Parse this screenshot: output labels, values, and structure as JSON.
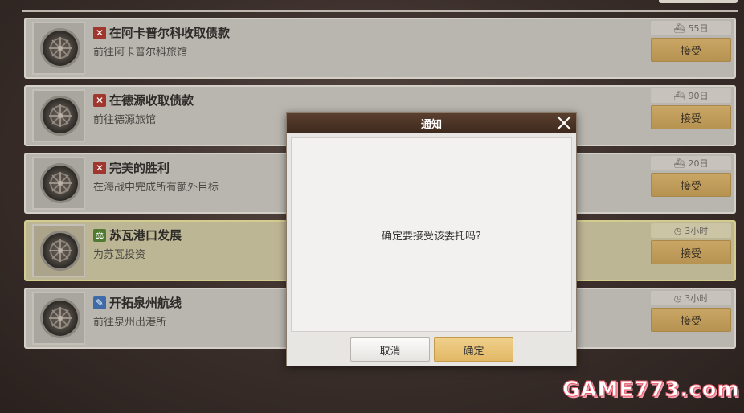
{
  "quests": [
    {
      "tag_icon": "crossed-swords-icon",
      "tag_color": "#a0362e",
      "title": "在阿卡普尔科收取债款",
      "subtitle": "前往阿卡普尔科旅馆",
      "time_icon": "ship-icon",
      "time": "55日",
      "accept_label": "接受",
      "highlighted": false
    },
    {
      "tag_icon": "crossed-swords-icon",
      "tag_color": "#a0362e",
      "title": "在德源收取债款",
      "subtitle": "前往德源旅馆",
      "time_icon": "ship-icon",
      "time": "90日",
      "accept_label": "接受",
      "highlighted": false
    },
    {
      "tag_icon": "crossed-swords-icon",
      "tag_color": "#a0362e",
      "title": "完美的胜利",
      "subtitle": "在海战中完成所有额外目标",
      "time_icon": "ship-icon",
      "time": "20日",
      "accept_label": "接受",
      "highlighted": false
    },
    {
      "tag_icon": "scales-icon",
      "tag_color": "#507a32",
      "title": "苏瓦港口发展",
      "subtitle": "为苏瓦投资",
      "time_icon": "clock-icon",
      "time": "3小时",
      "accept_label": "接受",
      "highlighted": true
    },
    {
      "tag_icon": "quill-icon",
      "tag_color": "#3e6aa8",
      "title": "开拓泉州航线",
      "subtitle": "前往泉州出港所",
      "time_icon": "clock-icon",
      "time": "3小时",
      "accept_label": "接受",
      "highlighted": false
    }
  ],
  "dialog": {
    "title": "通知",
    "message": "确定要接受该委托吗?",
    "cancel_label": "取消",
    "confirm_label": "确定"
  },
  "watermark": "GAME773.com",
  "colors": {
    "accept_button": "#c9a665",
    "confirm_button": "#e2b865",
    "dialog_header": "#4a3322",
    "highlight_row": "#bdb694"
  }
}
